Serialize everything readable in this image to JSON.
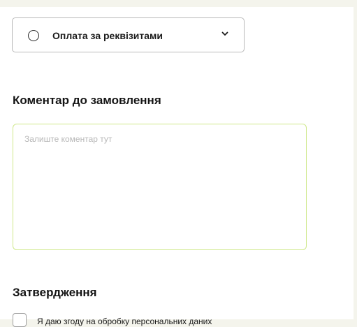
{
  "payment": {
    "selected_label": "Оплата за реквізитами",
    "radio_icon": "radio-unchecked-icon",
    "chevron_icon": "chevron-down-icon"
  },
  "comment": {
    "title": "Коментар до замовлення",
    "placeholder": "Залиште коментар тут",
    "value": "",
    "focus_border_color": "#cfe88a"
  },
  "confirmation": {
    "title": "Затвердження",
    "consent_label": "Я даю згоду на обробку персональних даних",
    "consent_checked": false
  }
}
